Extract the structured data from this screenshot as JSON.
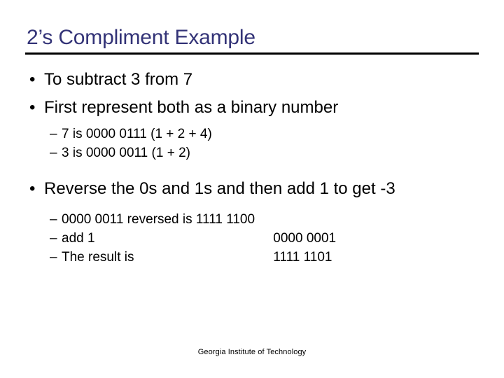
{
  "slide": {
    "title": "2’s Compliment Example",
    "title_color": "#333377",
    "body_color": "#000000",
    "background_color": "#ffffff",
    "bullet_glyph": "•",
    "dash_glyph": "–",
    "footer": "Georgia Institute of Technology"
  },
  "content": {
    "b1": {
      "text": "To subtract 3 from 7"
    },
    "b2": {
      "text": "First represent both as a binary number"
    },
    "b2_subs": [
      {
        "text": "7 is 0000 0111 (1 + 2 + 4)"
      },
      {
        "text": "3 is 0000 0011 (1 + 2)"
      }
    ],
    "b3": {
      "text": "Reverse the 0s and 1s and then add 1 to get -3"
    },
    "b3_subs": [
      {
        "label": "0000 0011 reversed is 1111 1100",
        "value": ""
      },
      {
        "label": " add 1",
        "value": "0000 0001"
      },
      {
        "label": "The result is",
        "value": "1111 1101"
      }
    ]
  }
}
